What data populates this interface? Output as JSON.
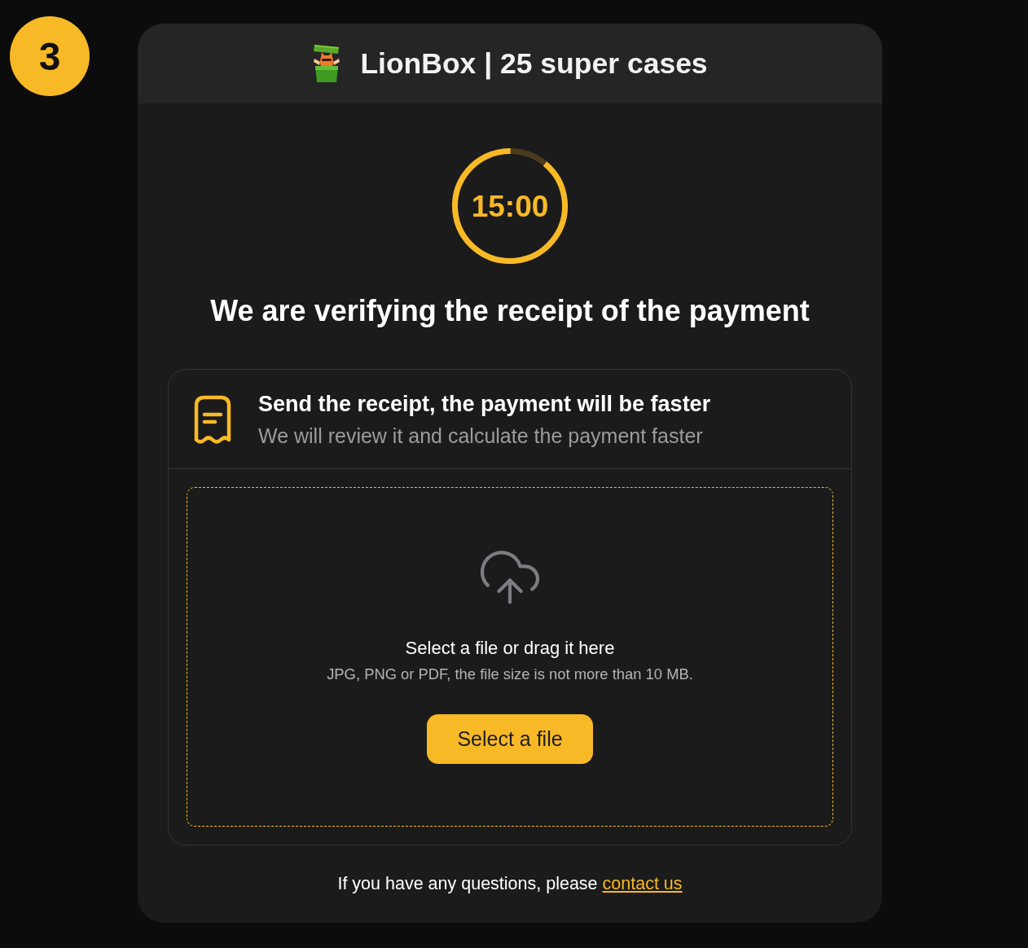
{
  "step": {
    "number": "3"
  },
  "header": {
    "title": "LionBox | 25 super cases"
  },
  "timer": {
    "time": "15:00",
    "level": 0.89
  },
  "heading": "We are verifying the receipt of the payment",
  "receipt_panel": {
    "title": "Send the receipt, the payment will be faster",
    "subtitle": "We will review it and calculate the payment faster"
  },
  "dropzone": {
    "prompt": "Select a file or drag it here",
    "hint": "JPG, PNG or PDF, the file size is not more than 10 MB.",
    "button": "Select a file"
  },
  "footer": {
    "text": "If you have any questions, please",
    "link": "contact us"
  }
}
